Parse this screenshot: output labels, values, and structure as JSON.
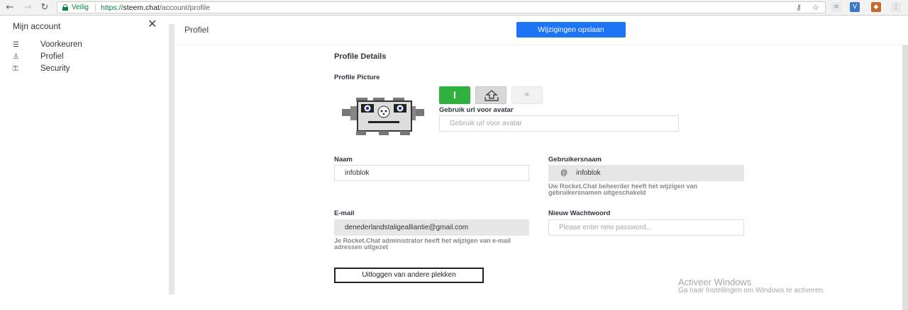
{
  "browser": {
    "secure_label": "Veilig",
    "url_scheme": "https://",
    "url_host": "steem.chat",
    "url_path": "/account/profile",
    "back_icon": "←",
    "forward_icon": "→",
    "reload_icon": "↻",
    "key_icon": "⚷",
    "star_icon": "☆"
  },
  "sidebar": {
    "title": "Mijn account",
    "close_icon": "✕",
    "items": [
      {
        "label": "Voorkeuren",
        "icon": "☰"
      },
      {
        "label": "Profiel",
        "icon": "♙"
      },
      {
        "label": "Security",
        "icon": "⚿"
      }
    ]
  },
  "header": {
    "title": "Profiel",
    "save_label": "Wijzigingen opslaan",
    "accent_color": "#1d74f5"
  },
  "profile": {
    "details_heading": "Profile Details",
    "picture_heading": "Profile Picture",
    "avatar_initial": "I",
    "link_icon": "⚭",
    "url_label": "Gebruik url voor avatar",
    "url_placeholder": "Gebruik url voor avatar",
    "name_label": "Naam",
    "name_value": "infoblok",
    "username_label": "Gebruikersnaam",
    "username_at": "@",
    "username_value": "infoblok",
    "username_help": "Uw Rocket.Chat beheerder heeft het wijzigen van gebruikersnamen uitgeschakeld",
    "email_label": "E-mail",
    "email_value": "denederlandstaligealliantie@gmail.com",
    "email_help": "Je Rocket.Chat administrator heeft het wijzigen van e-mail adressen uitgezet",
    "password_label": "Nieuw Wachtwoord",
    "password_placeholder": "Please enter new password...",
    "logout_label": "Uitloggen van andere plekken"
  },
  "watermark": {
    "line1": "Activeer Windows",
    "line2": "Ga naar Instellingen om Windows te activeren."
  }
}
